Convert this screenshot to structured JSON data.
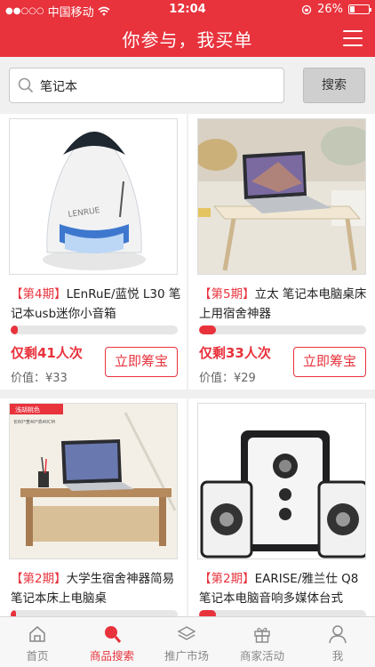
{
  "status_bar": {
    "signal": "●●○○○",
    "carrier": "中国移动",
    "time": "12:04",
    "battery": "26%",
    "battery_level": 0.26
  },
  "header": {
    "title": "你参与，我买单"
  },
  "search": {
    "value": "笔记本",
    "button_label": "搜索"
  },
  "products": [
    {
      "period": "【第4期】",
      "name": "LEnRuE/蓝悦 L30 笔记本usb迷你小音箱",
      "progress": 0.02,
      "remaining": "仅剩41人次",
      "price": "价值：¥33",
      "button": "立即筹宝"
    },
    {
      "period": "【第5期】",
      "name": "立太 笔记本电脑桌床上用宿舍神器",
      "progress": 0.1,
      "remaining": "仅剩33人次",
      "price": "价值：¥29",
      "button": "立即筹宝"
    },
    {
      "period": "【第2期】",
      "name": "大学生宿舍神器简易笔记本床上电脑桌",
      "progress": 0.0,
      "photo_text": [
        "浅胡桃色",
        "长60*宽40*高40CM"
      ]
    },
    {
      "period": "【第2期】",
      "name": "EARISE/雅兰仕 Q8笔记本电脑音响多媒体台式",
      "progress": 0.1
    }
  ],
  "tabs": [
    {
      "label": "首页",
      "icon": "home-icon",
      "active": false
    },
    {
      "label": "商品搜索",
      "icon": "search-icon",
      "active": true
    },
    {
      "label": "推广市场",
      "icon": "layers-icon",
      "active": false
    },
    {
      "label": "商家活动",
      "icon": "gift-icon",
      "active": false
    },
    {
      "label": "我",
      "icon": "user-icon",
      "active": false
    }
  ],
  "colors": {
    "accent": "#e8323c"
  }
}
